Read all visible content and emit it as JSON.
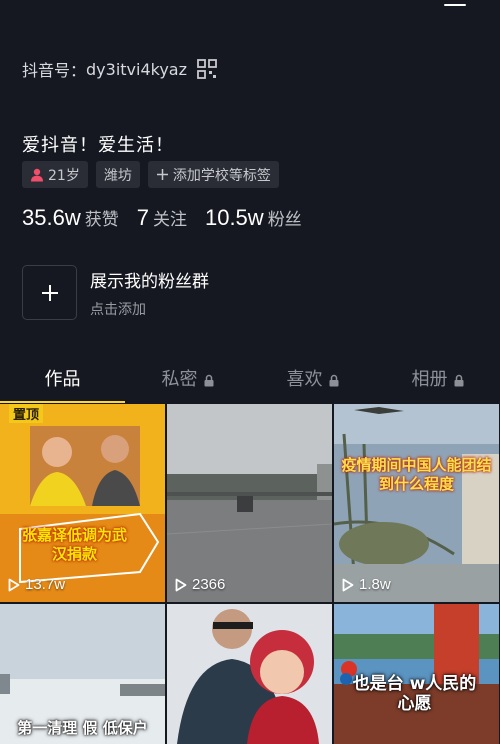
{
  "profile": {
    "id_label": "抖音号：",
    "id_value": "dy3itvi4kyaz",
    "bio": "爱抖音！爱生活！",
    "tags": [
      {
        "icon": "person-icon",
        "text": "21岁"
      },
      {
        "icon": "",
        "text": "潍坊"
      },
      {
        "icon": "plus-icon",
        "text": "添加学校等标签"
      }
    ],
    "stats": [
      {
        "value": "35.6w",
        "label": "获赞"
      },
      {
        "value": "7",
        "label": "关注"
      },
      {
        "value": "10.5w",
        "label": "粉丝"
      }
    ],
    "fans_group": {
      "title": "展示我的粉丝群",
      "subtitle": "点击添加"
    }
  },
  "tabs": [
    {
      "label": "作品",
      "active": true,
      "locked": false
    },
    {
      "label": "私密",
      "active": false,
      "locked": true
    },
    {
      "label": "喜欢",
      "active": false,
      "locked": true
    },
    {
      "label": "相册",
      "active": false,
      "locked": true
    }
  ],
  "videos": [
    {
      "pinned": "置顶",
      "caption": "张嘉译低调为武汉捐款",
      "plays": "13.7w"
    },
    {
      "caption": "",
      "plays": "2366"
    },
    {
      "caption": "疫情期间中国人能团结到什么程度",
      "plays": "1.8w"
    },
    {
      "caption": "第一清理 假 低保户",
      "plays": ""
    },
    {
      "caption": "",
      "plays": ""
    },
    {
      "caption": "也是台 w人民的心愿",
      "plays": ""
    }
  ],
  "colors": {
    "background": "#151821",
    "accent": "#fdd734",
    "tag_bg": "#2a2d36"
  }
}
